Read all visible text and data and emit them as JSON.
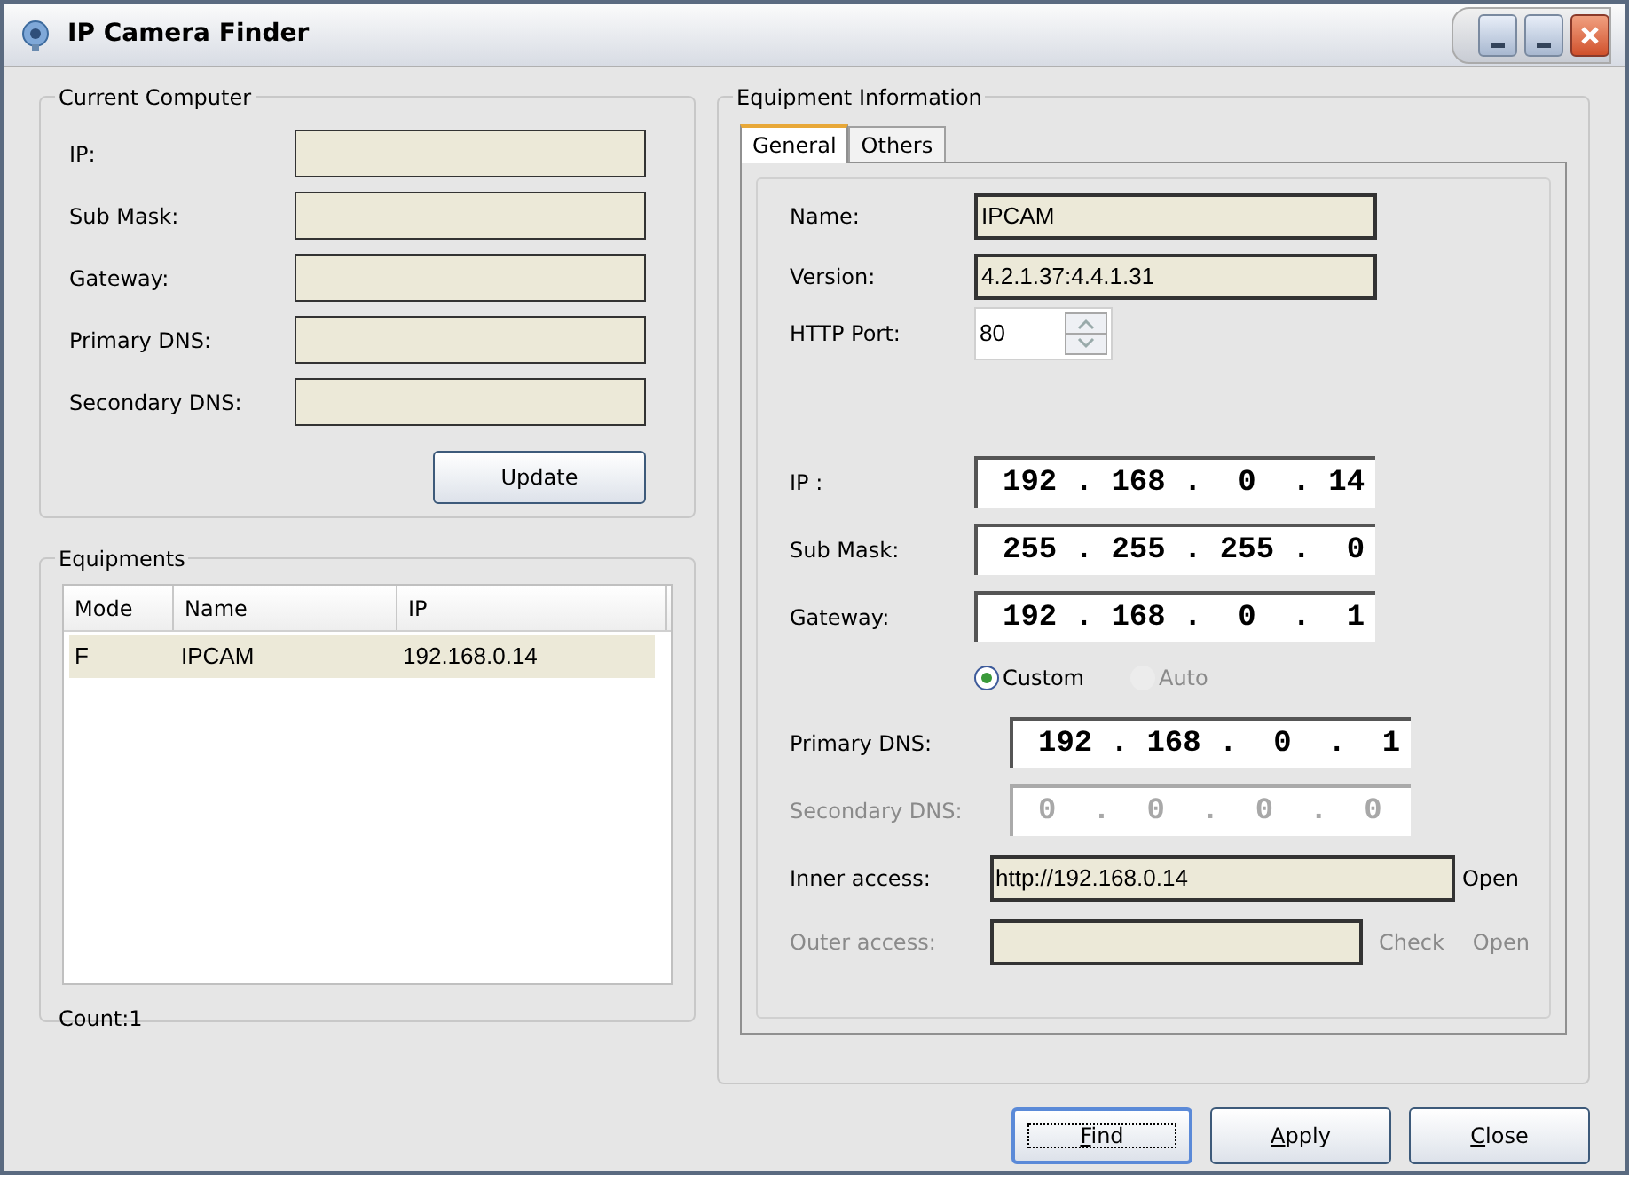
{
  "window": {
    "title": "IP Camera Finder"
  },
  "current_computer": {
    "title": "Current Computer",
    "fields": [
      {
        "label": "IP:"
      },
      {
        "label": "Sub Mask:"
      },
      {
        "label": "Gateway:"
      },
      {
        "label": "Primary DNS:"
      },
      {
        "label": "Secondary DNS:"
      }
    ],
    "button": "Update"
  },
  "equipments": {
    "title": "Equipments",
    "columns": [
      "Mode",
      "Name",
      "IP"
    ],
    "rows": [
      {
        "cells": [
          "F",
          "IPCAM",
          "192.168.0.14"
        ],
        "selected": true
      }
    ],
    "count": "Count:1"
  },
  "equipment_info": {
    "title": "Equipment Information",
    "tabs": [
      {
        "label": "General",
        "selected": true
      },
      {
        "label": "Others",
        "selected": false
      }
    ],
    "name": {
      "label": "Name:",
      "value": "IPCAM"
    },
    "version": {
      "label": "Version:",
      "value": "4.2.1.37:4.4.1.31"
    },
    "http_port": {
      "label": "HTTP Port:",
      "value": "80"
    },
    "ip_fields": [
      {
        "label": "IP :",
        "value": "192 . 168 .  0  . 14",
        "disabled": false
      },
      {
        "label": "Sub Mask:",
        "value": "255 . 255 . 255 .  0",
        "disabled": false
      },
      {
        "label": "Gateway:",
        "value": "192 . 168 .  0  .  1",
        "disabled": false
      }
    ],
    "radios": [
      {
        "label": "Custom",
        "selected": true,
        "disabled": false
      },
      {
        "label": "Auto",
        "selected": false,
        "disabled": true
      }
    ],
    "dns_fields": [
      {
        "label": "Primary DNS:",
        "value": "192 . 168 .  0  .  1",
        "disabled": false
      },
      {
        "label": "Secondary DNS:",
        "value": "0  .  0  .  0  .  0",
        "disabled": true
      }
    ],
    "access": [
      {
        "label": "Inner access:",
        "value": "http://192.168.0.14",
        "disabled": false,
        "links": [
          {
            "label": "Open",
            "disabled": false
          }
        ]
      },
      {
        "label": "Outer access:",
        "disabled": true,
        "links": [
          {
            "label": "Check",
            "disabled": true
          },
          {
            "label": "Open",
            "disabled": true
          }
        ]
      }
    ]
  },
  "buttons": [
    {
      "label": "Find",
      "focused": true
    },
    {
      "label": "Apply",
      "focused": false
    },
    {
      "label": "Close",
      "focused": false
    }
  ]
}
